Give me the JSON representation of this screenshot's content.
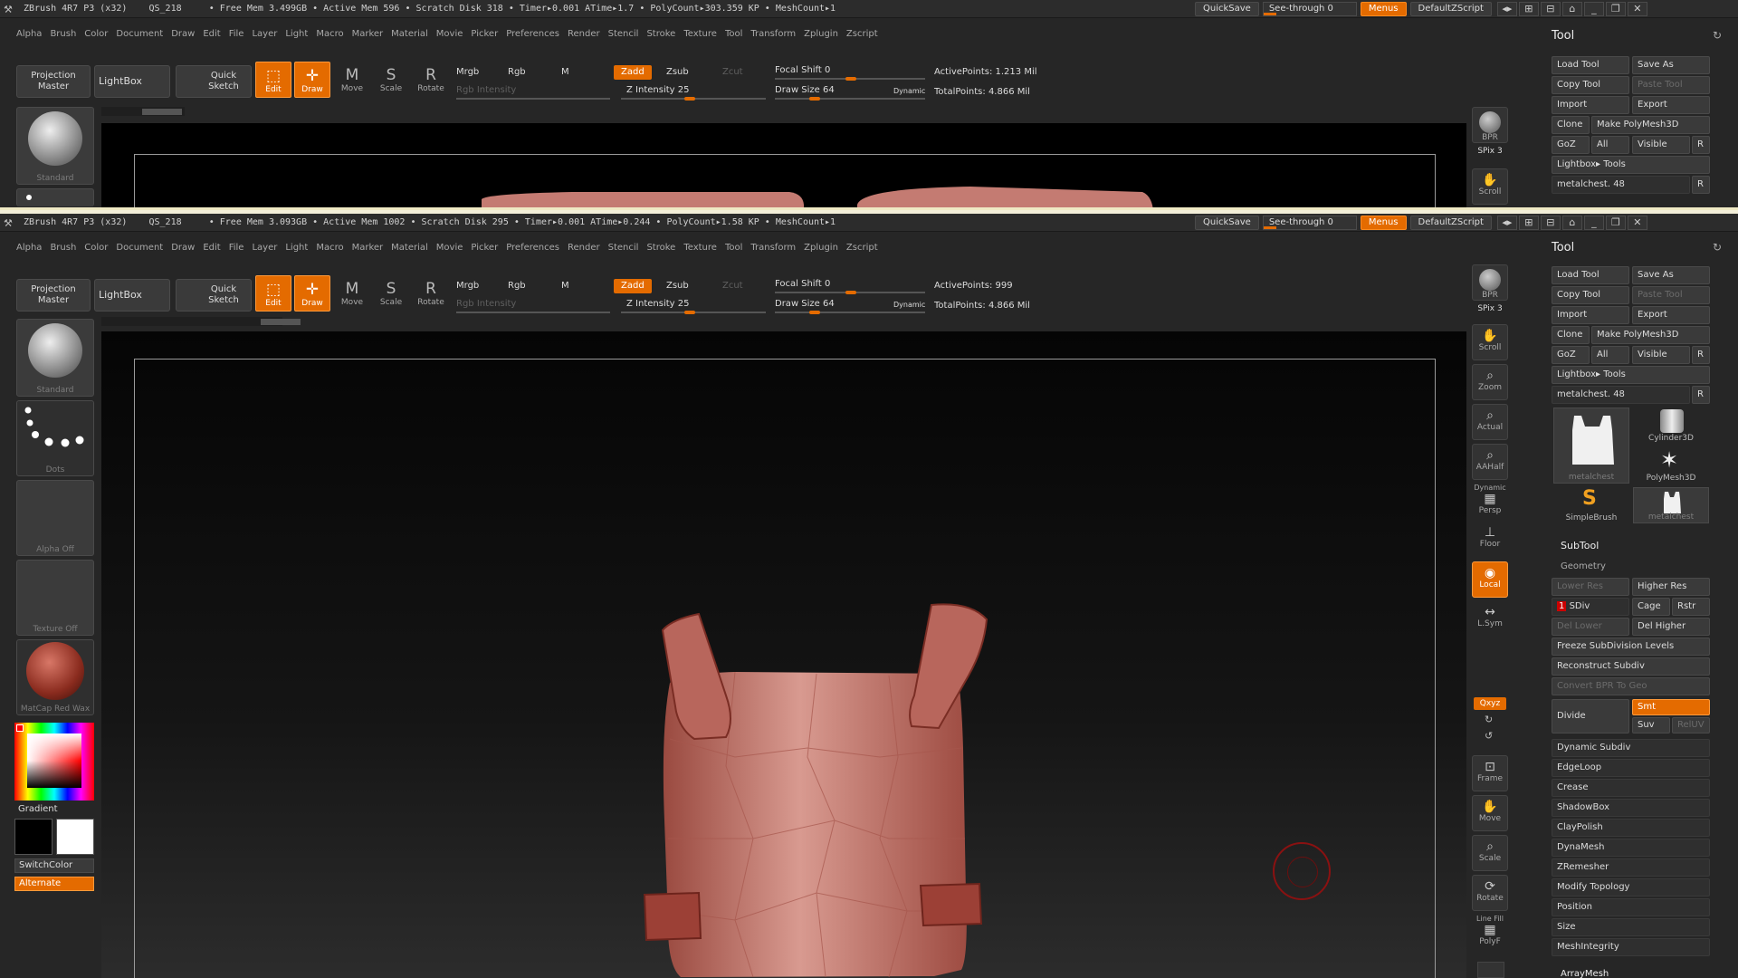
{
  "titlebar": {
    "app": "ZBrush 4R7 P3 (x32)",
    "doc": "QS_218",
    "top_stats": "• Free Mem 3.499GB • Active Mem 596 • Scratch Disk 318 • Timer▸0.001 ATime▸1.7 • PolyCount▸303.359 KP • MeshCount▸1",
    "bottom_stats": "• Free Mem 3.093GB • Active Mem 1002 • Scratch Disk 295 • Timer▸0.001 ATime▸0.244 • PolyCount▸1.58 KP • MeshCount▸1",
    "quicksave": "QuickSave",
    "seethrough": "See-through 0",
    "menus": "Menus",
    "script": "DefaultZScript"
  },
  "menu": [
    "Alpha",
    "Brush",
    "Color",
    "Document",
    "Draw",
    "Edit",
    "File",
    "Layer",
    "Light",
    "Macro",
    "Marker",
    "Material",
    "Movie",
    "Picker",
    "Preferences",
    "Render",
    "Stencil",
    "Stroke",
    "Texture",
    "Tool",
    "Transform",
    "Zplugin",
    "Zscript"
  ],
  "shelf": {
    "projection_master_1": "Projection",
    "projection_master_2": "Master",
    "lightbox": "LightBox",
    "quick_sketch_1": "Quick",
    "quick_sketch_2": "Sketch",
    "edit": "Edit",
    "draw": "Draw",
    "move": "Move",
    "scale": "Scale",
    "rotate": "Rotate",
    "mrgb": "Mrgb",
    "rgb": "Rgb",
    "m": "M",
    "rgb_intensity": "Rgb Intensity",
    "zadd": "Zadd",
    "zsub": "Zsub",
    "zcut": "Zcut",
    "z_intensity": "Z Intensity 25",
    "focal_shift": "Focal Shift 0",
    "draw_size": "Draw Size 64",
    "dynamic": "Dynamic",
    "active_points_top": "ActivePoints: 1.213 Mil",
    "active_points_bottom": "ActivePoints: 999",
    "total_points": "TotalPoints: 4.866 Mil"
  },
  "left_tray": {
    "standard": "Standard",
    "dots": "Dots",
    "alpha_off": "Alpha Off",
    "texture_off": "Texture Off",
    "matcap": "MatCap Red Wax",
    "gradient": "Gradient",
    "switch_color": "SwitchColor",
    "alternate": "Alternate"
  },
  "right_tray": {
    "bpr": "BPR",
    "spix": "SPix 3",
    "scroll": "Scroll",
    "zoom": "Zoom",
    "actual": "Actual",
    "aahalf": "AAHalf",
    "dynamic": "Dynamic",
    "persp": "Persp",
    "floor": "Floor",
    "local": "Local",
    "lsym": "L.Sym",
    "xyz": "Qxyz",
    "frame": "Frame",
    "move": "Move",
    "scale": "Scale",
    "rotate": "Rotate",
    "line_fill": "Line Fill",
    "polyf": "PolyF"
  },
  "tool_panel": {
    "title": "Tool",
    "load_tool": "Load Tool",
    "save_as": "Save As",
    "copy_tool": "Copy Tool",
    "paste_tool": "Paste Tool",
    "import": "Import",
    "export": "Export",
    "clone": "Clone",
    "make_polymesh": "Make PolyMesh3D",
    "goz": "GoZ",
    "all": "All",
    "visible": "Visible",
    "r": "R",
    "lightbox_tools": "Lightbox▸ Tools",
    "current_tool": "metalchest. 48",
    "thumbs": [
      "metalchest",
      "Cylinder3D",
      "PolyMesh3D",
      "SimpleBrush",
      "metalchest"
    ],
    "subtool": "SubTool",
    "geometry": "Geometry",
    "lower_res": "Lower Res",
    "higher_res": "Higher Res",
    "sdiv": "SDiv",
    "sdiv_value": "1",
    "cage": "Cage",
    "rstr": "Rstr",
    "del_lower": "Del Lower",
    "del_higher": "Del Higher",
    "freeze": "Freeze SubDivision Levels",
    "reconstruct": "Reconstruct Subdiv",
    "convert_bpr": "Convert BPR To Geo",
    "divide": "Divide",
    "smt": "Smt",
    "suv": "Suv",
    "reluv": "RelUV",
    "sections": [
      "Dynamic Subdiv",
      "EdgeLoop",
      "Crease",
      "ShadowBox",
      "ClayPolish",
      "DynaMesh",
      "ZRemesher",
      "Modify Topology",
      "Position",
      "Size",
      "MeshIntegrity"
    ],
    "arraymesh": "ArrayMesh"
  },
  "colors": {
    "accent": "#e46b00",
    "mesh": "#b45c52",
    "canvas": "#000000"
  }
}
